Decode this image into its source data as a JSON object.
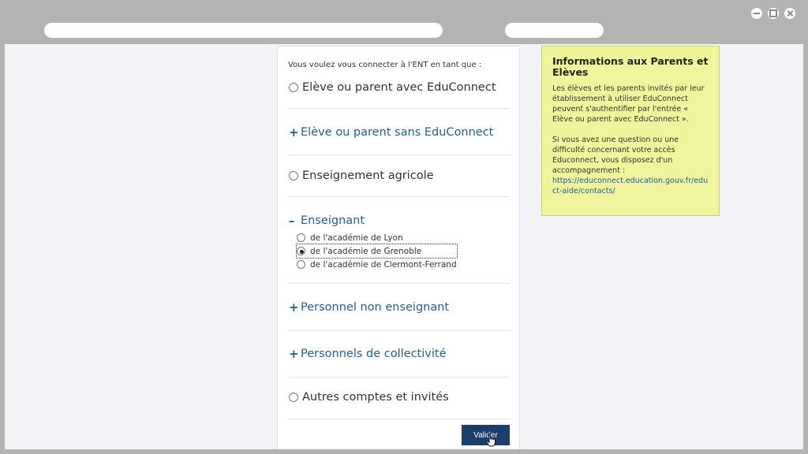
{
  "login": {
    "intro": "Vous voulez vous connecter à l'ENT en tant que :",
    "options": [
      {
        "label": "Elève ou parent avec EduConnect",
        "kind": "radio"
      },
      {
        "label": "Elève ou parent sans EduConnect",
        "kind": "expand",
        "sign": "+"
      },
      {
        "label": "Enseignement agricole",
        "kind": "radio"
      },
      {
        "label": "Enseignant",
        "kind": "collapse",
        "sign": "–"
      },
      {
        "label": "Personnel non enseignant",
        "kind": "expand",
        "sign": "+"
      },
      {
        "label": "Personnels de collectivité",
        "kind": "expand",
        "sign": "+"
      },
      {
        "label": "Autres comptes et invités",
        "kind": "radio"
      }
    ],
    "enseignant_sub": [
      {
        "label": "de l'académie de Lyon",
        "checked": false
      },
      {
        "label": "de l'académie de Grenoble",
        "checked": true
      },
      {
        "label": "de l'académie de Clermont-Ferrand",
        "checked": false
      }
    ],
    "submit_label": "Valider"
  },
  "info": {
    "title": "Informations aux Parents et Elèves",
    "paragraph1": "Les élèves et les parents invités par leur établissement à utiliser EduConnect peuvent s'authentifier par l'entrée « Elève ou parent avec EduConnect ».",
    "paragraph2": "Si vous avez une question ou une difficulté concernant votre accès Educonnect, vous disposez d'un accompagnement :",
    "link": "https://educonnect.education.gouv.fr/educt-aide/contacts/"
  },
  "colors": {
    "accent_blue": "#1f5f94",
    "button_bg": "#1c3e6c",
    "info_bg": "#f0f59b"
  }
}
